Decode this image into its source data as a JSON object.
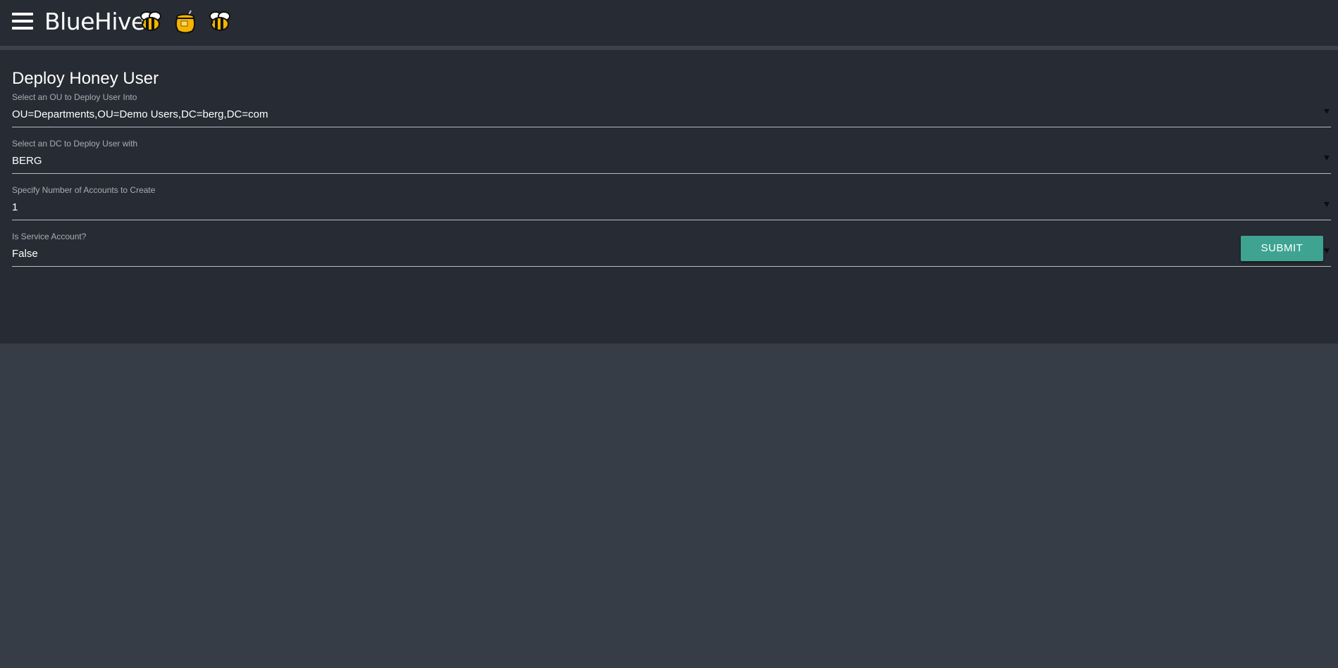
{
  "app": {
    "title": "BlueHive",
    "header_icons": [
      "bee-icon",
      "honey-pot-icon",
      "bee-icon"
    ]
  },
  "colors": {
    "topbar_bg": "#272b33",
    "page_bg": "#373d46",
    "panel_bg": "#272b33",
    "accent": "#3fa391"
  },
  "form": {
    "title": "Deploy Honey User",
    "fields": [
      {
        "label": "Select an OU to Deploy User Into",
        "value": "OU=Departments,OU=Demo Users,DC=berg,DC=com"
      },
      {
        "label": "Select an DC to Deploy User with",
        "value": "BERG"
      },
      {
        "label": "Specify Number of Accounts to Create",
        "value": "1"
      },
      {
        "label": "Is Service Account?",
        "value": "False"
      }
    ],
    "submit_label": "SUBMIT"
  }
}
